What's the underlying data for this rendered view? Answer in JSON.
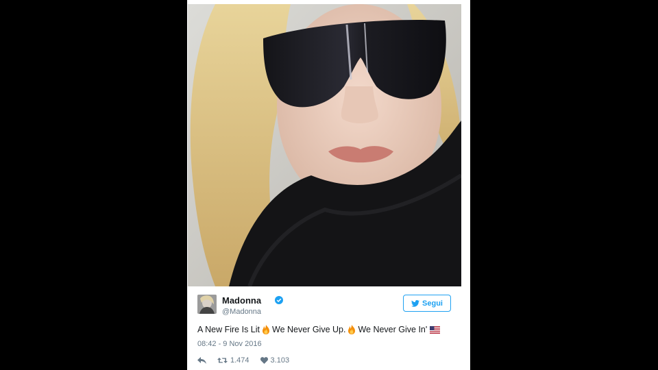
{
  "photo": {
    "alt": ""
  },
  "tweet": {
    "user_name": "Madonna",
    "user_handle": "@Madonna",
    "follow_label": "Segui",
    "text_part1": "A New Fire Is Lit",
    "text_part2": "We Never Give Up.",
    "text_part3": "We Never Give In'",
    "timestamp": "08:42 - 9 Nov 2016",
    "retweets": "1.474",
    "likes": "3.103"
  },
  "colors": {
    "twitter_blue": "#1da1f2",
    "text_gray": "#657786"
  },
  "icons": [
    "twitter-bird-icon",
    "verified-badge-icon",
    "reply-icon",
    "retweet-icon",
    "heart-icon",
    "fire-emoji-icon",
    "us-flag-icon"
  ]
}
